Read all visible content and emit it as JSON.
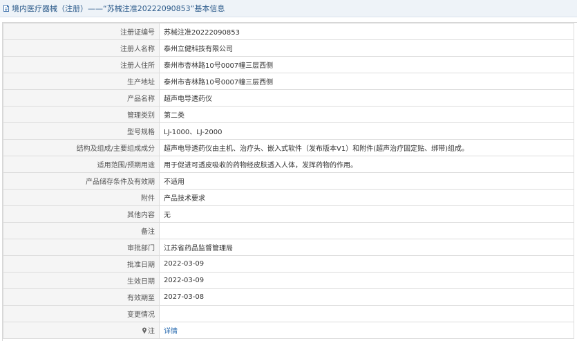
{
  "header": {
    "title": "境内医疗器械（注册）——“苏械注准20222090853”基本信息"
  },
  "rows": [
    {
      "label": "注册证编号",
      "value": "苏械注准20222090853"
    },
    {
      "label": "注册人名称",
      "value": "泰州立健科技有限公司"
    },
    {
      "label": "注册人住所",
      "value": "泰州市杏林路10号0007幢三层西侧"
    },
    {
      "label": "生产地址",
      "value": "泰州市杏林路10号0007幢三层西侧"
    },
    {
      "label": "产品名称",
      "value": "超声电导透药仪"
    },
    {
      "label": "管理类别",
      "value": "第二类"
    },
    {
      "label": "型号规格",
      "value": "LJ-1000、LJ-2000"
    },
    {
      "label": "结构及组成/主要组成成分",
      "value": "超声电导透药仪由主机、治疗头、嵌入式软件（发布版本V1）和附件(超声治疗固定贴、绑带)组成。"
    },
    {
      "label": "适用范围/预期用途",
      "value": "用于促进可透皮吸收的药物经皮肤透入人体，发挥药物的作用。"
    },
    {
      "label": "产品储存条件及有效期",
      "value": "不适用"
    },
    {
      "label": "附件",
      "value": "产品技术要求"
    },
    {
      "label": "其他内容",
      "value": "无"
    },
    {
      "label": "备注",
      "value": ""
    },
    {
      "label": "审批部门",
      "value": "江苏省药品监督管理局"
    },
    {
      "label": "批准日期",
      "value": "2022-03-09"
    },
    {
      "label": "生效日期",
      "value": "2022-03-09"
    },
    {
      "label": "有效期至",
      "value": "2027-03-08"
    },
    {
      "label": "变更情况",
      "value": ""
    }
  ],
  "note_row": {
    "label": "注",
    "link_text": "详情",
    "icon": "pin-icon"
  },
  "colors": {
    "header_bg": "#eef3f8",
    "header_text": "#2b5a8a",
    "label_bg": "#f5f5f5",
    "border": "#dcdcdc",
    "link": "#2b6cb0"
  }
}
